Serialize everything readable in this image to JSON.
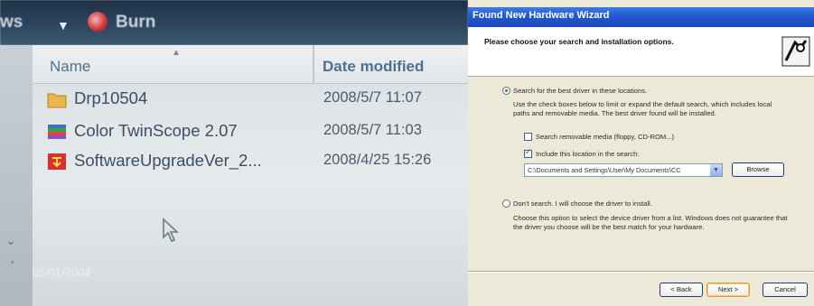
{
  "explorer": {
    "toolbar": {
      "prev_item_label": "ws",
      "burn_label": "Burn"
    },
    "columns": {
      "name": "Name",
      "date_modified": "Date modified"
    },
    "files": [
      {
        "name": "Drp10504",
        "date": "2008/5/7 11:07",
        "icon": "folder-icon"
      },
      {
        "name": "Color TwinScope 2.07",
        "date": "2008/5/7 11:03",
        "icon": "application-icon"
      },
      {
        "name": "SoftwareUpgradeVer_2...",
        "date": "2008/4/25 15:26",
        "icon": "installer-icon"
      }
    ],
    "photo_timestamp": "05/01/2008"
  },
  "wizard": {
    "title": "Found New Hardware Wizard",
    "header_text": "Please choose your search and installation options.",
    "option_search_label": "Search for the best driver in these locations.",
    "option_search_desc_line1": "Use the check boxes below to limit or expand the default search, which includes local",
    "option_search_desc_line2": "paths and removable media. The best driver found will be installed.",
    "checkbox_removable_label": "Search removable media (floppy, CD-ROM...)",
    "checkbox_include_label": "Include this location in the search:",
    "location_value": "C:\\Documents and Settings\\User\\My Documents\\CC",
    "browse_label": "Browse",
    "option_dont_search_label": "Don't search. I will choose the driver to install.",
    "option_dont_desc_line1": "Choose this option to select the device driver from a list.  Windows does not guarantee that",
    "option_dont_desc_line2": "the driver you choose will be the best match for your hardware.",
    "back_label": "< Back",
    "next_label": "Next >",
    "cancel_label": "Cancel",
    "state": {
      "search_selected": true,
      "removable_checked": false,
      "include_checked": true
    }
  },
  "colors": {
    "xp_title_blue": "#2358cf",
    "xp_dialog_bg": "#ece9d8",
    "explorer_text": "#3b4f63"
  }
}
